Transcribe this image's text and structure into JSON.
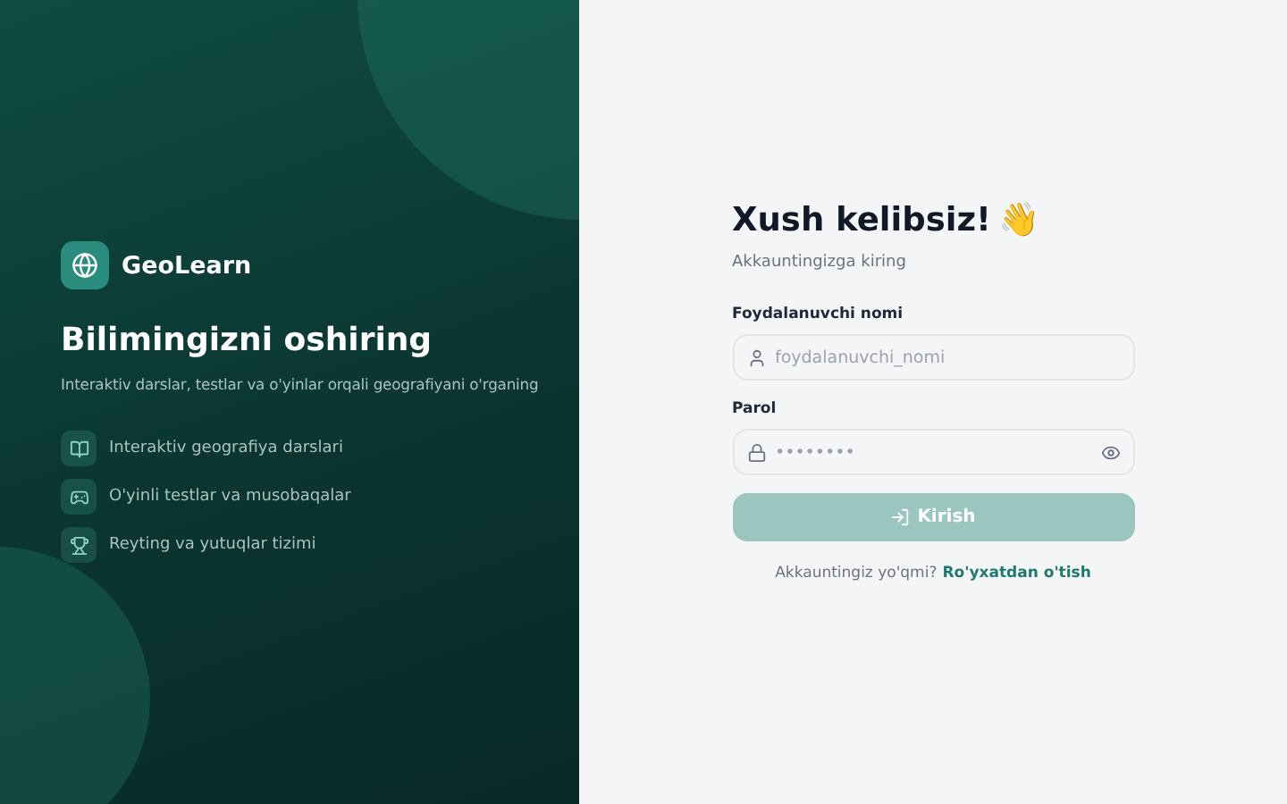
{
  "brand": {
    "name": "GeoLearn"
  },
  "hero": {
    "title": "Bilimingizni oshiring",
    "subtitle": "Interaktiv darslar, testlar va o'yinlar orqali geografiyani o'rganing"
  },
  "features": [
    {
      "kind": "book",
      "label": "Interaktiv geografiya darslari"
    },
    {
      "kind": "gamepad",
      "label": "O'yinli testlar va musobaqalar"
    },
    {
      "kind": "trophy",
      "label": "Reyting va yutuqlar tizimi"
    }
  ],
  "login": {
    "title": "Xush kelibsiz!",
    "emoji": "👋",
    "subtitle": "Akkauntingizga kiring",
    "fields": [
      {
        "kind": "user",
        "label": "Foydalanuvchi nomi",
        "placeholder": "foydalanuvchi_nomi"
      },
      {
        "kind": "password",
        "label": "Parol",
        "placeholder": "••••••••"
      }
    ],
    "submit": {
      "label": "Kirish",
      "disabled": true
    },
    "footer": {
      "text": "Akkauntingiz yo'qmi?",
      "link": "Ro'yxatdan o'tish"
    }
  }
}
